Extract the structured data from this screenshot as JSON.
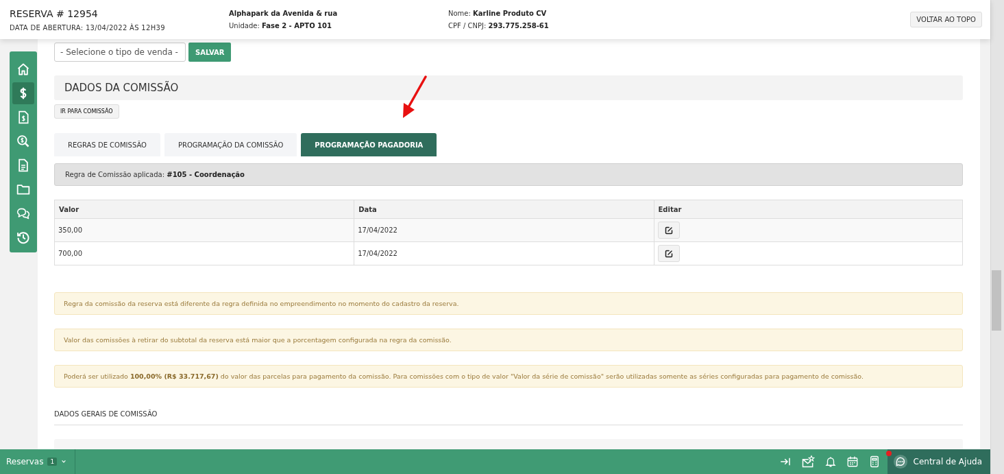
{
  "header": {
    "title": "RESERVA # 12954",
    "opened": "DATA DE ABERTURA: 13/04/2022 ÀS 12H39",
    "project": "Alphapark da Avenida & rua",
    "unit_label": "Unidade:",
    "unit": "Fase 2 - APTO 101",
    "name_label": "Nome:",
    "name": "Karline Produto CV",
    "doc_label": "CPF / CNPJ:",
    "doc": "293.775.258-61",
    "top_button": "VOLTAR AO TOPO"
  },
  "sidebar": {
    "items": [
      {
        "selected": false
      },
      {
        "selected": true
      },
      {
        "selected": false
      },
      {
        "selected": false
      },
      {
        "selected": false
      },
      {
        "selected": false
      },
      {
        "selected": false
      },
      {
        "selected": false
      }
    ]
  },
  "sale_type": {
    "placeholder": "- Selecione o tipo de venda -",
    "save": "SALVAR"
  },
  "section": {
    "title": "DADOS DA COMISSÃO",
    "goto": "IR PARA COMISSÃO"
  },
  "tabs": [
    {
      "label": "REGRAS DE COMISSÃO",
      "selected": false
    },
    {
      "label": "PROGRAMAÇÃO DA COMISSÃO",
      "selected": false
    },
    {
      "label": "PROGRAMAÇÃO PAGADORIA",
      "selected": true
    }
  ],
  "rule": "Regra de Comissão aplicada: **#105 - Coordenação**",
  "table": {
    "columns": [
      "Valor",
      "Data",
      "Editar"
    ],
    "rows": [
      {
        "valor": "350,00",
        "data": "17/04/2022"
      },
      {
        "valor": "700,00",
        "data": "17/04/2022"
      }
    ]
  },
  "alerts": [
    "Regra da comissão da reserva está diferente da regra definida no empreendimento no momento do cadastro da reserva.",
    "Valor das comissões à retirar do subtotal da reserva está maior que a porcentagem configurada na regra da comissão.",
    "Poderá ser utilizado **100,00% (R$ 33.717,67)** do valor das parcelas para pagamento da comissão. Para comissões com o tipo de valor \"Valor da série de comissão\" serão utilizadas somente as séries configuradas para pagamento de comissão."
  ],
  "general_title": "DADOS GERAIS DE COMISSÃO",
  "footer": {
    "tab": "Reservas",
    "count": "1",
    "help": "Central de Ajuda",
    "help_notification": true
  }
}
